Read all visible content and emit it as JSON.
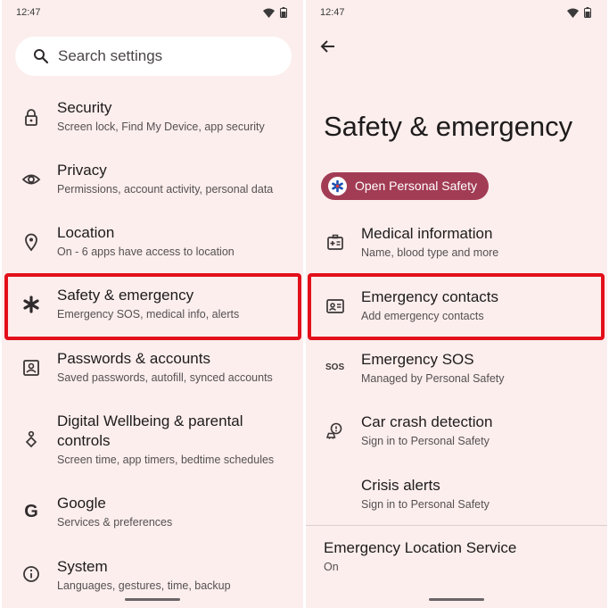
{
  "left": {
    "status": {
      "time": "12:47"
    },
    "search": {
      "placeholder": "Search settings"
    },
    "items": [
      {
        "icon": "lock-icon",
        "title": "Security",
        "subtitle": "Screen lock, Find My Device, app security"
      },
      {
        "icon": "eye-icon",
        "title": "Privacy",
        "subtitle": "Permissions, account activity, personal data"
      },
      {
        "icon": "location-pin-icon",
        "title": "Location",
        "subtitle": "On - 6 apps have access to location"
      },
      {
        "icon": "asterisk-icon",
        "title": "Safety & emergency",
        "subtitle": "Emergency SOS, medical info, alerts"
      },
      {
        "icon": "account-box-icon",
        "title": "Passwords & accounts",
        "subtitle": "Saved passwords, autofill, synced accounts"
      },
      {
        "icon": "wellbeing-icon",
        "title_line1": "Digital Wellbeing & parental",
        "title_line2": "controls",
        "subtitle": "Screen time, app timers, bedtime schedules"
      },
      {
        "icon": "google-g-icon",
        "title": "Google",
        "subtitle": "Services & preferences"
      },
      {
        "icon": "info-icon",
        "title": "System",
        "subtitle": "Languages, gestures, time, backup"
      }
    ]
  },
  "right": {
    "status": {
      "time": "12:47"
    },
    "page_title": "Safety & emergency",
    "chip_label": "Open Personal Safety",
    "items": [
      {
        "icon": "medical-info-icon",
        "title": "Medical information",
        "subtitle": "Name, blood type and more"
      },
      {
        "icon": "contact-card-icon",
        "title": "Emergency contacts",
        "subtitle": "Add emergency contacts"
      },
      {
        "icon": "sos-icon",
        "icon_text": "SOS",
        "title": "Emergency SOS",
        "subtitle": "Managed by Personal Safety"
      },
      {
        "icon": "car-crash-icon",
        "title": "Car crash detection",
        "subtitle": "Sign in to Personal Safety"
      },
      {
        "title": "Crisis alerts",
        "subtitle": "Sign in to Personal Safety"
      },
      {
        "title": "Emergency Location Service",
        "subtitle": "On"
      }
    ]
  },
  "colors": {
    "background": "#fbeeed",
    "highlight": "#e3101b",
    "chip": "#a23c54"
  }
}
